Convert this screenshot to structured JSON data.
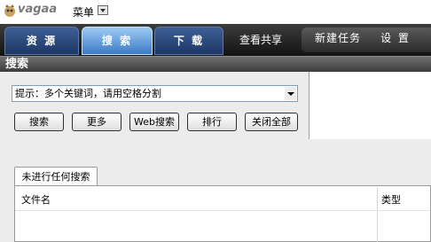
{
  "app": {
    "logo_text": "vagaa",
    "menu_label": "菜单"
  },
  "nav": {
    "tabs": [
      {
        "label": "资 源"
      },
      {
        "label": "搜 索"
      },
      {
        "label": "下 载"
      },
      {
        "label": "查看共享"
      }
    ],
    "new_task_label": "新建任务",
    "settings_label": "设 置"
  },
  "search": {
    "header_label": "搜索",
    "input_placeholder": "提示：多个关键词，请用空格分割",
    "buttons": {
      "search": "搜索",
      "more": "更多",
      "web_search": "Web搜索",
      "sort": "排行",
      "close_all": "关闭全部"
    }
  },
  "results": {
    "tab_label": "未进行任何搜索",
    "columns": {
      "filename": "文件名",
      "type": "类型"
    }
  },
  "colors": {
    "nav_bg": "#1a1a1a",
    "active_tab": "#6aa6e0",
    "inactive_tab": "#2a4a80"
  }
}
